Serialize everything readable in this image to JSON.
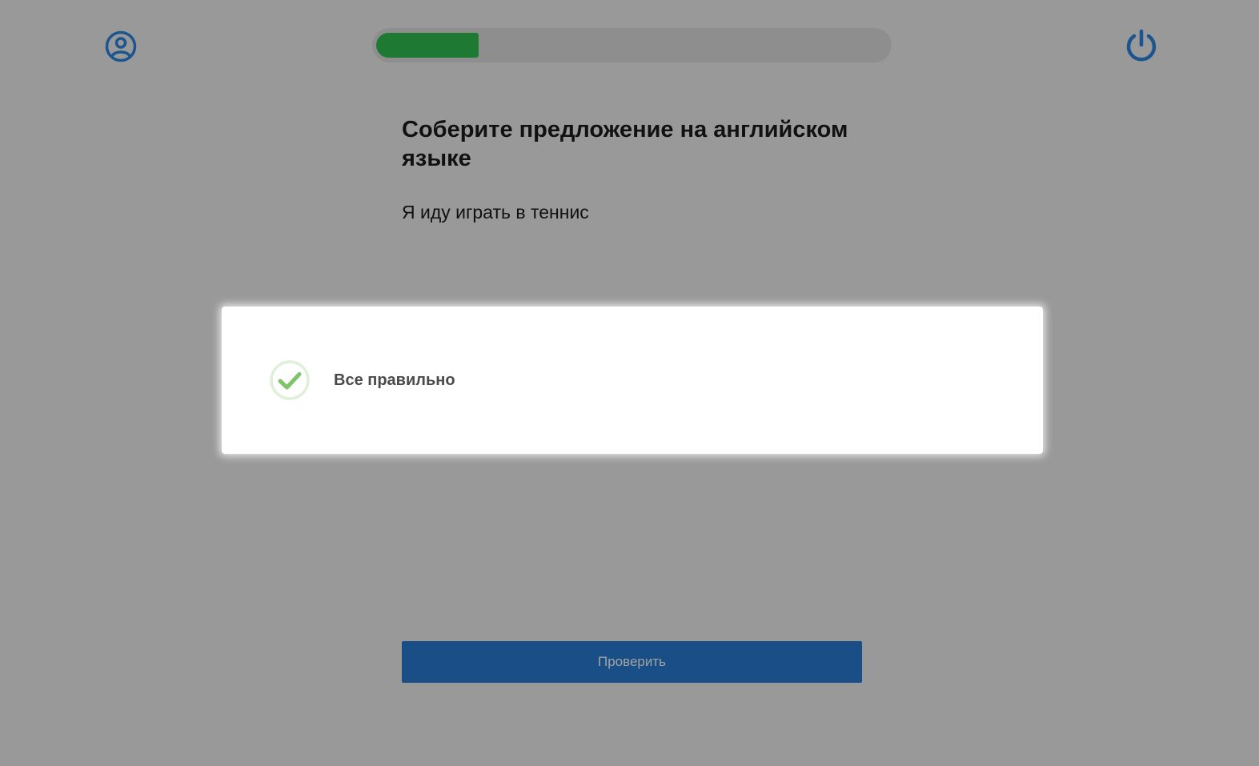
{
  "header": {
    "profile_icon": "user-circle-icon",
    "power_icon": "power-icon",
    "progress": {
      "value": 0.2
    },
    "colors": {
      "icon": "#1b5590",
      "progress_fill": "#1e7a32",
      "progress_track": "#8e8e8e"
    }
  },
  "task": {
    "title": "Соберите предложение на английском языке",
    "sentence": "Я иду играть в теннис"
  },
  "result": {
    "icon": "check-circle-icon",
    "message": "Все правильно",
    "colors": {
      "check": "#7dc46a",
      "ring": "#dff0d8"
    }
  },
  "actions": {
    "check_label": "Проверить",
    "colors": {
      "background": "#194f86",
      "text": "#a3a3a3"
    }
  },
  "page": {
    "background": "#999999"
  }
}
